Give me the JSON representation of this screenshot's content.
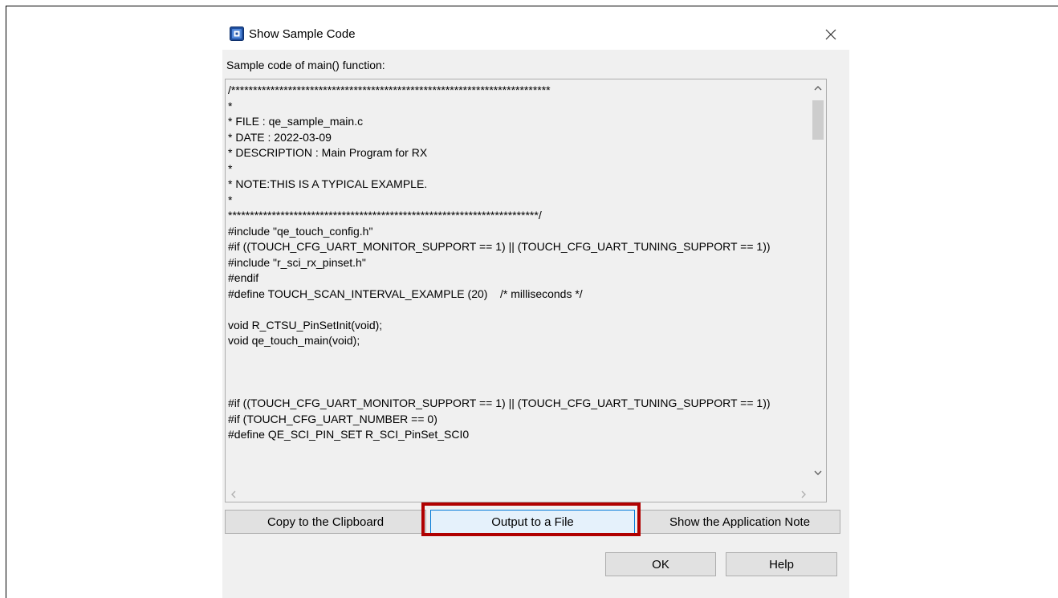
{
  "dialog": {
    "title": "Show Sample Code",
    "description": "Sample code of main() function:",
    "code_lines": [
      "/*************************************************************************",
      "*",
      "* FILE : qe_sample_main.c",
      "* DATE : 2022-03-09",
      "* DESCRIPTION : Main Program for RX",
      "*",
      "* NOTE:THIS IS A TYPICAL EXAMPLE.",
      "*",
      "***********************************************************************/",
      "#include \"qe_touch_config.h\"",
      "#if ((TOUCH_CFG_UART_MONITOR_SUPPORT == 1) || (TOUCH_CFG_UART_TUNING_SUPPORT == 1))",
      "#include \"r_sci_rx_pinset.h\"",
      "#endif",
      "#define TOUCH_SCAN_INTERVAL_EXAMPLE (20)    /* milliseconds */",
      "",
      "void R_CTSU_PinSetInit(void);",
      "void qe_touch_main(void);",
      "",
      "",
      "",
      "#if ((TOUCH_CFG_UART_MONITOR_SUPPORT == 1) || (TOUCH_CFG_UART_TUNING_SUPPORT == 1))",
      "#if (TOUCH_CFG_UART_NUMBER == 0)",
      "#define QE_SCI_PIN_SET R_SCI_PinSet_SCI0"
    ],
    "buttons": {
      "copy": "Copy to the Clipboard",
      "output": "Output to a File",
      "app_note": "Show the Application Note",
      "ok": "OK",
      "help": "Help"
    }
  },
  "colors": {
    "highlight": "#b00000",
    "focus": "#0078d7",
    "dialog_bg": "#f0f0f0"
  },
  "icons": {
    "app": "renesas-app-icon",
    "close": "close-icon"
  }
}
